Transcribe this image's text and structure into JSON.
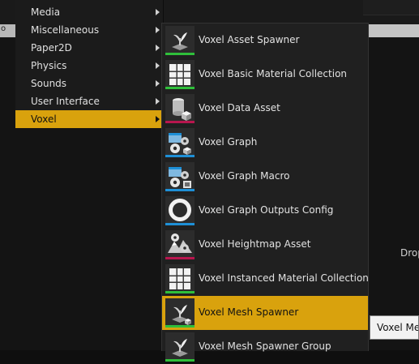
{
  "background": {
    "drop_label": "Drop",
    "strip_left_glyph": "o"
  },
  "category_menu": {
    "items": [
      {
        "label": "Media",
        "has_submenu": true
      },
      {
        "label": "Miscellaneous",
        "has_submenu": true
      },
      {
        "label": "Paper2D",
        "has_submenu": true
      },
      {
        "label": "Physics",
        "has_submenu": true
      },
      {
        "label": "Sounds",
        "has_submenu": true
      },
      {
        "label": "User Interface",
        "has_submenu": true
      },
      {
        "label": "Voxel",
        "has_submenu": true,
        "active": true
      }
    ]
  },
  "voxel_submenu": {
    "items": [
      {
        "label": "Voxel Asset Spawner",
        "icon": "sprout-spawner-icon",
        "accent": "#2fbf3a"
      },
      {
        "label": "Voxel Basic Material Collection",
        "icon": "material-grid-icon",
        "accent": "#2fbf3a"
      },
      {
        "label": "Voxel Data Asset",
        "icon": "data-asset-icon",
        "accent": "#b8164e"
      },
      {
        "label": "Voxel Graph",
        "icon": "graph-gears-icon",
        "accent": "#1e8fd6"
      },
      {
        "label": "Voxel Graph Macro",
        "icon": "graph-macro-gears-icon",
        "accent": "#1e8fd6"
      },
      {
        "label": "Voxel Graph Outputs Config",
        "icon": "ring-icon",
        "accent": "#1e8fd6"
      },
      {
        "label": "Voxel Heightmap Asset",
        "icon": "heightmap-gears-icon",
        "accent": "#b8164e"
      },
      {
        "label": "Voxel Instanced Material Collection",
        "icon": "material-grid-icon",
        "accent": "#2fbf3a"
      },
      {
        "label": "Voxel Mesh Spawner",
        "icon": "mesh-spawner-icon",
        "accent": "#2fbf3a",
        "active": true
      },
      {
        "label": "Voxel Mesh Spawner Group",
        "icon": "sprout-spawner-icon",
        "accent": "#2fbf3a"
      }
    ]
  },
  "tooltip": {
    "text": "Voxel Mesh Spawner"
  },
  "colors": {
    "highlight": "#d9a20d",
    "menu_bg": "#1b1b1b",
    "submenu_bg": "#202020"
  }
}
